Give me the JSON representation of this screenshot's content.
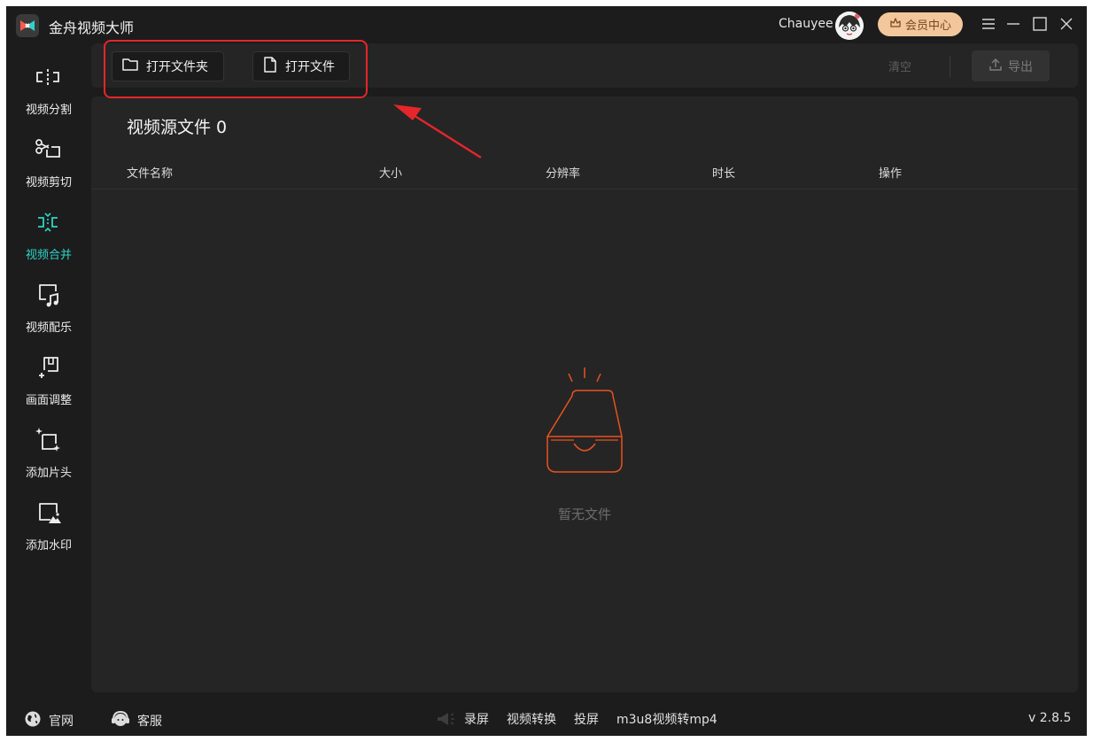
{
  "app": {
    "title": "金舟视频大师"
  },
  "header": {
    "user_name": "Chauyee",
    "vip_label": "会员中心"
  },
  "sidebar": {
    "items": [
      {
        "label": "视频分割",
        "icon": "split-icon",
        "active": false
      },
      {
        "label": "视频剪切",
        "icon": "scissors-icon",
        "active": false
      },
      {
        "label": "视频合并",
        "icon": "merge-icon",
        "active": true
      },
      {
        "label": "视频配乐",
        "icon": "music-icon",
        "active": false
      },
      {
        "label": "画面调整",
        "icon": "crop-icon",
        "active": false
      },
      {
        "label": "添加片头",
        "icon": "sparkle-frame-icon",
        "active": false
      },
      {
        "label": "添加水印",
        "icon": "watermark-icon",
        "active": false
      }
    ]
  },
  "toolbar": {
    "open_folder": "打开文件夹",
    "open_file": "打开文件",
    "clear": "清空",
    "export": "导出"
  },
  "main": {
    "title": "视频源文件 0",
    "columns": [
      "文件名称",
      "大小",
      "分辨率",
      "时长",
      "操作"
    ],
    "empty_text": "暂无文件"
  },
  "statusbar": {
    "website": "官网",
    "support": "客服",
    "links": [
      "录屏",
      "视频转换",
      "投屏",
      "m3u8视频转mp4"
    ],
    "version": "v 2.8.5"
  },
  "colors": {
    "accent": "#2ed3c6",
    "vip": "#f2c79c",
    "annotation": "#e5262a",
    "empty_icon": "#e8531e"
  }
}
